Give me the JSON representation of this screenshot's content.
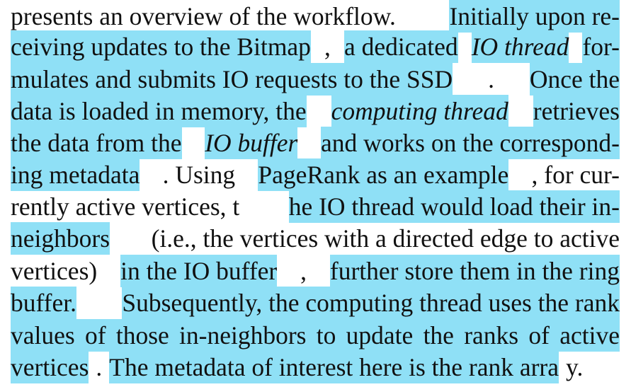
{
  "highlight_color": "#8fe0f6",
  "lines": [
    [
      {
        "t": "presents an overview of the workflow.",
        "hl": false
      },
      {
        "t": "Initially upon re-",
        "hl": true
      }
    ],
    [
      {
        "t": "ceiving updates to the Bitmap",
        "hl": true
      },
      {
        "t": ",",
        "hl": false
      },
      {
        "t": "a dedicated",
        "hl": true
      },
      {
        "t": "IO thread",
        "hl": true,
        "it": true
      },
      {
        "t": "for-",
        "hl": true
      }
    ],
    [
      {
        "t": "mulates and submits IO requests to the SSD",
        "hl": true
      },
      {
        "t": ".",
        "hl": false
      },
      {
        "t": "Once the",
        "hl": true
      }
    ],
    [
      {
        "t": "data is loaded in memory, the",
        "hl": true
      },
      {
        "t": "computing thread",
        "hl": true,
        "it": true
      },
      {
        "t": "retrieves",
        "hl": true
      }
    ],
    [
      {
        "t": "the data from the",
        "hl": true
      },
      {
        "t": "IO buffer",
        "hl": true,
        "it": true
      },
      {
        "t": "and works on the correspond-",
        "hl": true
      }
    ],
    [
      {
        "t": "ing metadata",
        "hl": true
      },
      {
        "t": ". Using",
        "hl": false
      },
      {
        "t": "PageRank as an example",
        "hl": true
      },
      {
        "t": ", for cur-",
        "hl": false
      }
    ],
    [
      {
        "t": "rently active vertices, t",
        "hl": false
      },
      {
        "t": "he IO thread would load their in-",
        "hl": true
      }
    ],
    [
      {
        "t": "neighbors",
        "hl": true
      },
      {
        "t": "(i.e., the vertices with a directed edge to active",
        "hl": false
      }
    ],
    [
      {
        "t": "vertices)",
        "hl": false
      },
      {
        "t": "in the IO buffer",
        "hl": true
      },
      {
        "t": ",",
        "hl": false
      },
      {
        "t": "further store them in the ring",
        "hl": true
      }
    ],
    [
      {
        "t": "buffer.",
        "hl": true
      },
      {
        "t": "Subsequently, the computing thread uses the rank",
        "hl": true
      }
    ],
    [
      {
        "t": "values of those in-neighbors to update the ranks of active",
        "hl": true
      }
    ],
    [
      {
        "t": "vertices",
        "hl": true
      },
      {
        "t": ".",
        "hl": false
      },
      {
        "t": "The metadata of interest here is the rank arra",
        "hl": true
      },
      {
        "t": "y.",
        "hl": false
      }
    ]
  ]
}
